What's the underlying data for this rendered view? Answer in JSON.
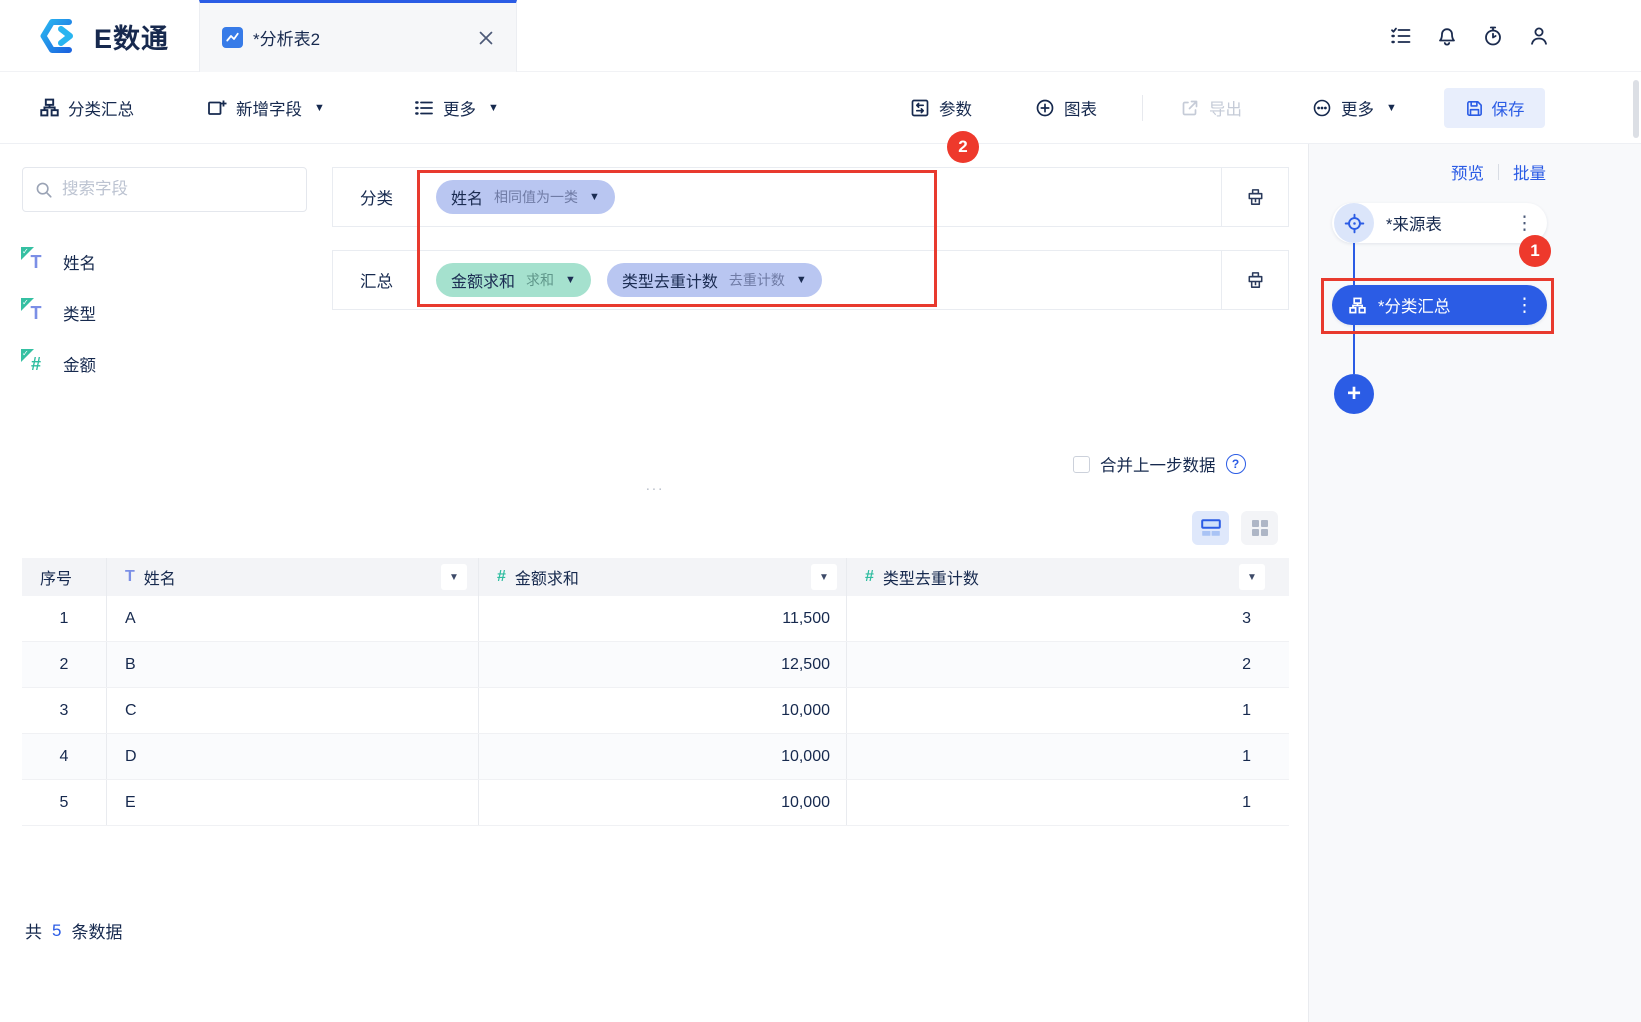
{
  "header": {
    "logo_text": "E数通",
    "tab_title": "*分析表2"
  },
  "toolbar": {
    "group_button": "分类汇总",
    "add_field_button": "新增字段",
    "more_left_button": "更多",
    "params_button": "参数",
    "chart_button": "图表",
    "export_button": "导出",
    "more_right_button": "更多",
    "save_button": "保存"
  },
  "fields_panel": {
    "search_placeholder": "搜索字段",
    "fields": [
      {
        "label": "姓名",
        "type": "text"
      },
      {
        "label": "类型",
        "type": "text"
      },
      {
        "label": "金额",
        "type": "number"
      }
    ]
  },
  "config": {
    "category_label": "分类",
    "category_pill": {
      "name": "姓名",
      "mode": "相同值为一类"
    },
    "summary_label": "汇总",
    "summary_pill_1": {
      "name": "金额求和",
      "mode": "求和"
    },
    "summary_pill_2": {
      "name": "类型去重计数",
      "mode": "去重计数"
    },
    "merge_checkbox_label": "合并上一步数据",
    "merge_checkbox_checked": false,
    "collapse_handle": "..."
  },
  "table": {
    "columns": [
      "序号",
      "姓名",
      "金额求和",
      "类型去重计数"
    ],
    "rows": [
      [
        "1",
        "A",
        "11,500",
        "3"
      ],
      [
        "2",
        "B",
        "12,500",
        "2"
      ],
      [
        "3",
        "C",
        "10,000",
        "1"
      ],
      [
        "4",
        "D",
        "10,000",
        "1"
      ],
      [
        "5",
        "E",
        "10,000",
        "1"
      ]
    ],
    "footer_prefix": "共",
    "footer_count": "5",
    "footer_suffix": "条数据"
  },
  "flow_panel": {
    "preview_link": "预览",
    "batch_link": "批量",
    "source_node": "*来源表",
    "group_node": "*分类汇总"
  },
  "annotations": {
    "badge_1": "1",
    "badge_2": "2"
  },
  "icons": {
    "top_right": [
      "task-list",
      "bell",
      "stopwatch",
      "user"
    ],
    "toolbar": [
      "hierarchy",
      "add-field",
      "list",
      "parameters",
      "plus-circle",
      "export",
      "more-circle",
      "save"
    ],
    "other": [
      "search",
      "chart-tab",
      "clear-brush",
      "question-circle",
      "table-view",
      "card-view",
      "target",
      "kebab-menu",
      "plus"
    ]
  },
  "colors": {
    "accent_blue": "#2b5ce5",
    "annotation_red": "#ee392c",
    "teal": "#35c0a2",
    "pill_purple": "#b9c6f1",
    "pill_teal": "#a5e1ce",
    "header_gray": "#f3f4f7"
  }
}
